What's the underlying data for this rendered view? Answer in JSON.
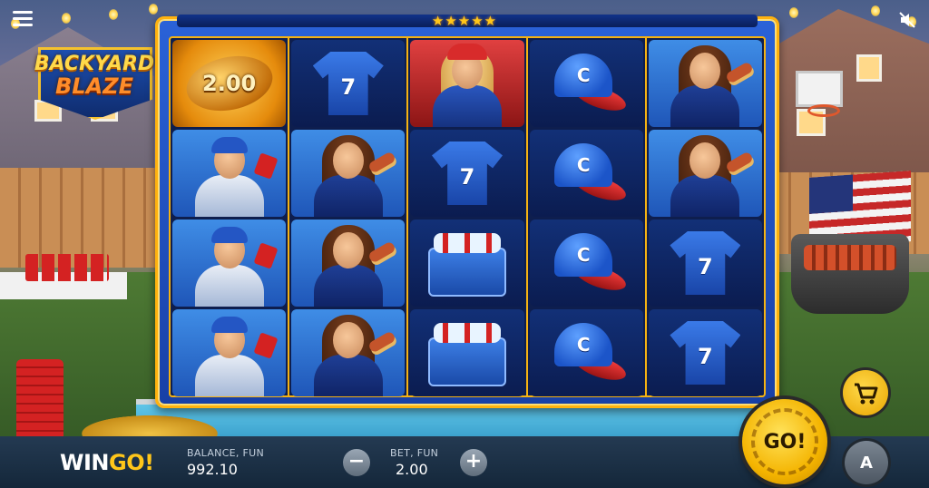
{
  "game": {
    "logo_line1": "BACKYARD",
    "logo_line2": "BLAZE",
    "brand_prefix": "WIN",
    "brand_suffix": "GO!",
    "rating_stars": 5
  },
  "icons": {
    "menu": "menu-icon",
    "sound": "sound-off-icon",
    "cart": "cart-icon",
    "spin_arrows": "spin-arrows-icon"
  },
  "reels": [
    [
      {
        "symbol": "football-multiplier",
        "value": "2.00",
        "bg": "gold"
      },
      {
        "symbol": "fan-man",
        "bg": "blue"
      },
      {
        "symbol": "fan-man",
        "bg": "blue"
      },
      {
        "symbol": "fan-man",
        "bg": "blue"
      }
    ],
    [
      {
        "symbol": "jersey",
        "number": "7",
        "bg": "dark"
      },
      {
        "symbol": "fan-girl",
        "bg": "blue"
      },
      {
        "symbol": "fan-girl",
        "bg": "blue"
      },
      {
        "symbol": "fan-girl",
        "bg": "blue"
      }
    ],
    [
      {
        "symbol": "blonde-fan",
        "bg": "red"
      },
      {
        "symbol": "jersey",
        "number": "7",
        "bg": "dark"
      },
      {
        "symbol": "cooler",
        "bg": "dark"
      },
      {
        "symbol": "cooler",
        "bg": "dark"
      }
    ],
    [
      {
        "symbol": "cap",
        "letter": "C",
        "bg": "dark"
      },
      {
        "symbol": "cap",
        "letter": "C",
        "bg": "dark"
      },
      {
        "symbol": "cap",
        "letter": "C",
        "bg": "dark"
      },
      {
        "symbol": "cap",
        "letter": "C",
        "bg": "dark"
      }
    ],
    [
      {
        "symbol": "fan-girl",
        "bg": "blue"
      },
      {
        "symbol": "fan-girl",
        "bg": "blue"
      },
      {
        "symbol": "jersey",
        "number": "7",
        "bg": "dark"
      },
      {
        "symbol": "jersey",
        "number": "7",
        "bg": "dark"
      }
    ]
  ],
  "bottom_bar": {
    "balance_label": "BALANCE, FUN",
    "balance_value": "992.10",
    "bet_label": "BET, FUN",
    "bet_value": "2.00",
    "minus_label": "−",
    "plus_label": "+",
    "spin_label": "GO!",
    "auto_label": "A"
  },
  "colors": {
    "frame_gold": "#ffb20e",
    "frame_blue": "#1f4fc0",
    "accent_yellow": "#ffc61a",
    "bar_dark": "#14273a"
  }
}
